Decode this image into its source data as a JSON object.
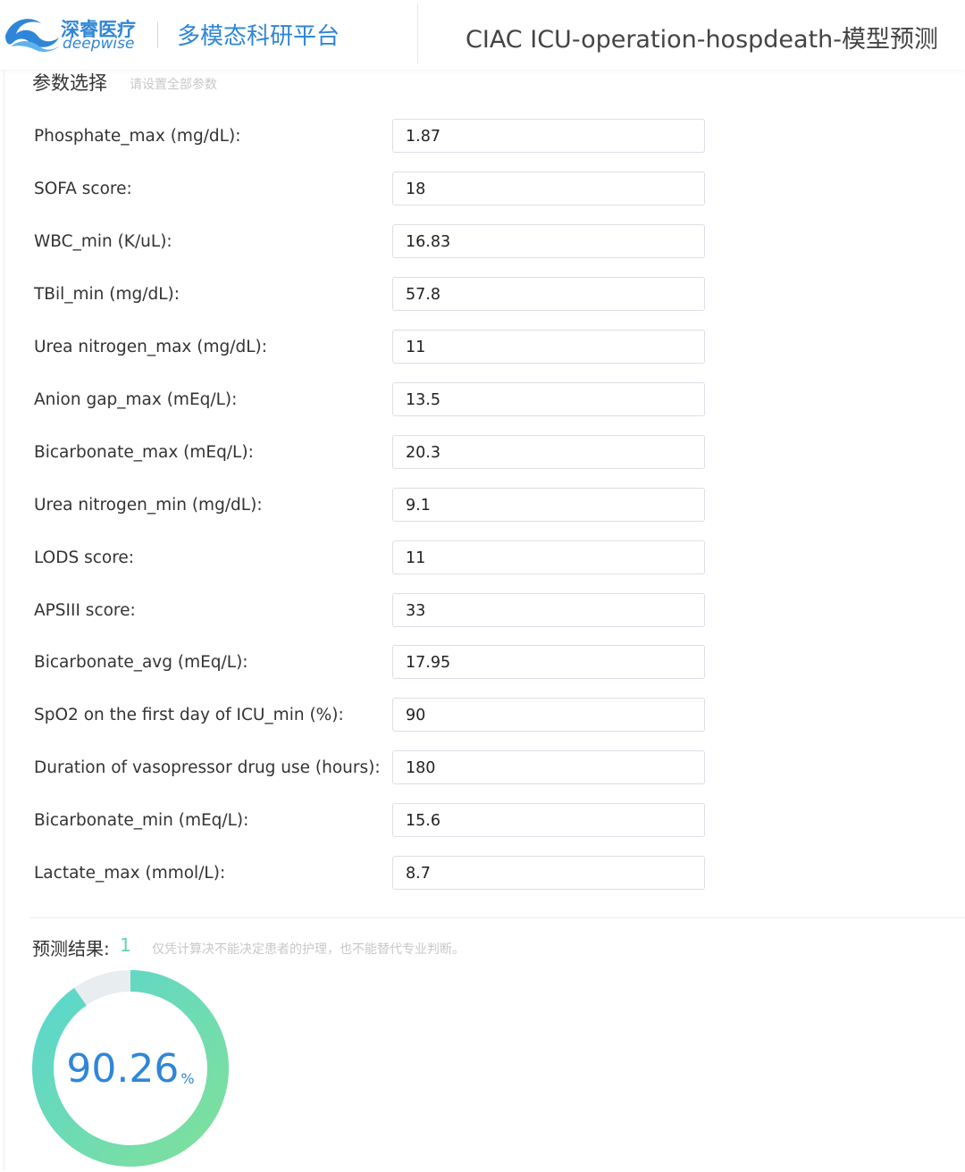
{
  "header": {
    "logo_cn": "深睿医疗",
    "logo_en": "deepwise",
    "platform_title": "多模态科研平台",
    "page_title": "CIAC ICU-operation-hospdeath-模型预测"
  },
  "params": {
    "title": "参数选择",
    "hint": "请设置全部参数",
    "items": [
      {
        "label": "Phosphate_max (mg/dL):",
        "value": "1.87"
      },
      {
        "label": "SOFA score:",
        "value": "18"
      },
      {
        "label": "WBC_min (K/uL):",
        "value": "16.83"
      },
      {
        "label": "TBil_min (mg/dL):",
        "value": "57.8"
      },
      {
        "label": "Urea nitrogen_max (mg/dL):",
        "value": "11"
      },
      {
        "label": "Anion gap_max (mEq/L):",
        "value": "13.5"
      },
      {
        "label": "Bicarbonate_max (mEq/L):",
        "value": "20.3"
      },
      {
        "label": "Urea nitrogen_min (mg/dL):",
        "value": "9.1"
      },
      {
        "label": "LODS score:",
        "value": "11"
      },
      {
        "label": "APSIII score:",
        "value": "33"
      },
      {
        "label": "Bicarbonate_avg (mEq/L):",
        "value": "17.95"
      },
      {
        "label": "SpO2 on the first day of ICU_min (%):",
        "value": "90"
      },
      {
        "label": "Duration of vasopressor drug use (hours):",
        "value": "180"
      },
      {
        "label": "Bicarbonate_min (mEq/L):",
        "value": "15.6"
      },
      {
        "label": "Lactate_max (mmol/L):",
        "value": "8.7"
      }
    ]
  },
  "result": {
    "label": "预测结果:",
    "value": "1",
    "note": "仅凭计算决不能决定患者的护理，也不能替代专业判断。",
    "percent_text": "90.26",
    "percent_symbol": "%",
    "fraction": 0.9026
  },
  "colors": {
    "brand_blue": "#2f86d8",
    "gauge_start": "#7fe09a",
    "gauge_end": "#5ad6cf",
    "gauge_track": "#e8edf0",
    "result_value": "#5fd3b3"
  }
}
